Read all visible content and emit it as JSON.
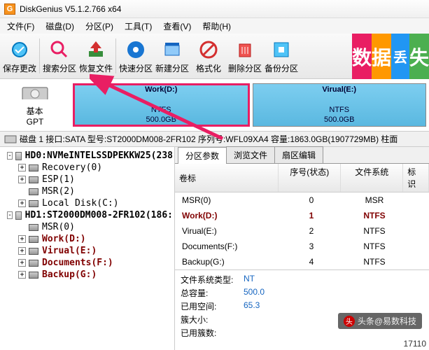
{
  "title": "DiskGenius V5.1.2.766 x64",
  "menu": [
    "文件(F)",
    "磁盘(D)",
    "分区(P)",
    "工具(T)",
    "查看(V)",
    "帮助(H)"
  ],
  "toolbar": [
    {
      "label": "保存更改"
    },
    {
      "label": "搜索分区"
    },
    {
      "label": "恢复文件"
    },
    {
      "label": "快速分区"
    },
    {
      "label": "新建分区"
    },
    {
      "label": "格式化"
    },
    {
      "label": "删除分区"
    },
    {
      "label": "备份分区"
    }
  ],
  "banner": [
    "数",
    "据",
    "丢",
    "失"
  ],
  "disklabel": {
    "basic": "基本",
    "type": "GPT",
    "icon_label": "磁盘 1"
  },
  "partitions": [
    {
      "name": "Work(D:)",
      "fs": "NTFS",
      "size": "500.0GB",
      "selected": true
    },
    {
      "name": "Virual(E:)",
      "fs": "NTFS",
      "size": "500.0GB",
      "selected": false
    }
  ],
  "status": "磁盘 1  接口:SATA  型号:ST2000DM008-2FR102  序列号:WFL09XA4  容量:1863.0GB(1907729MB)  柱面",
  "tree": [
    {
      "type": "hd",
      "label": "HD0:NVMeINTELSSDPEKKW25(238",
      "exp": "-"
    },
    {
      "type": "p",
      "label": "Recovery(0)",
      "exp": "+",
      "bold": false
    },
    {
      "type": "p",
      "label": "ESP(1)",
      "exp": "+",
      "bold": false
    },
    {
      "type": "p",
      "label": "MSR(2)",
      "exp": "",
      "bold": false
    },
    {
      "type": "p",
      "label": "Local Disk(C:)",
      "exp": "+",
      "bold": false
    },
    {
      "type": "hd",
      "label": "HD1:ST2000DM008-2FR102(186:",
      "exp": "-"
    },
    {
      "type": "p",
      "label": "MSR(0)",
      "exp": "",
      "bold": false
    },
    {
      "type": "p",
      "label": "Work(D:)",
      "exp": "+",
      "bold": true
    },
    {
      "type": "p",
      "label": "Virual(E:)",
      "exp": "+",
      "bold": true
    },
    {
      "type": "p",
      "label": "Documents(F:)",
      "exp": "+",
      "bold": true
    },
    {
      "type": "p",
      "label": "Backup(G:)",
      "exp": "+",
      "bold": true
    }
  ],
  "tabs": [
    "分区参数",
    "浏览文件",
    "扇区编辑"
  ],
  "table": {
    "headers": [
      "卷标",
      "序号(状态)",
      "文件系统",
      "标识"
    ],
    "rows": [
      {
        "name": "MSR(0)",
        "seq": "0",
        "fs": "MSR",
        "sel": false
      },
      {
        "name": "Work(D:)",
        "seq": "1",
        "fs": "NTFS",
        "sel": true
      },
      {
        "name": "Virual(E:)",
        "seq": "2",
        "fs": "NTFS",
        "sel": false
      },
      {
        "name": "Documents(F:)",
        "seq": "3",
        "fs": "NTFS",
        "sel": false
      },
      {
        "name": "Backup(G:)",
        "seq": "4",
        "fs": "NTFS",
        "sel": false
      }
    ]
  },
  "details": [
    {
      "lbl": "文件系统类型:",
      "val": "NT"
    },
    {
      "lbl": "总容量:",
      "val": "500.0"
    },
    {
      "lbl": "已用空间:",
      "val": "65.3"
    },
    {
      "lbl": "簇大小:",
      "val": ""
    },
    {
      "lbl": "已用簇数:",
      "val": ""
    }
  ],
  "watermark": "头条@易数科技",
  "bottomnum": "17110"
}
